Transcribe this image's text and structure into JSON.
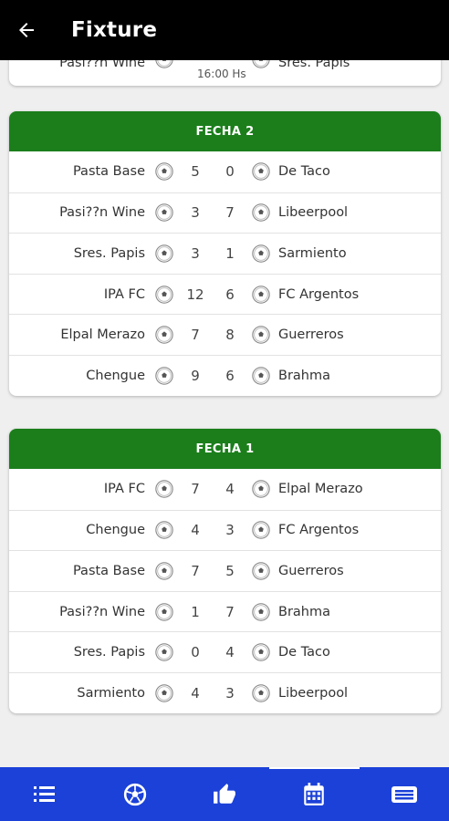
{
  "appbar": {
    "title": "Fixture"
  },
  "partial_match": {
    "home": "Pasi??n Wine",
    "time": "16:00 Hs",
    "away": "Sres. Papis"
  },
  "fechas": [
    {
      "title": "FECHA 2",
      "matches": [
        {
          "home": "Pasta Base",
          "home_score": "5",
          "away_score": "0",
          "away": "De Taco"
        },
        {
          "home": "Pasi??n Wine",
          "home_score": "3",
          "away_score": "7",
          "away": "Libeerpool"
        },
        {
          "home": "Sres. Papis",
          "home_score": "3",
          "away_score": "1",
          "away": "Sarmiento"
        },
        {
          "home": "IPA FC",
          "home_score": "12",
          "away_score": "6",
          "away": "FC Argentos"
        },
        {
          "home": "Elpal Merazo",
          "home_score": "7",
          "away_score": "8",
          "away": "Guerreros"
        },
        {
          "home": "Chengue",
          "home_score": "9",
          "away_score": "6",
          "away": "Brahma"
        }
      ]
    },
    {
      "title": "FECHA 1",
      "matches": [
        {
          "home": "IPA FC",
          "home_score": "7",
          "away_score": "4",
          "away": "Elpal Merazo"
        },
        {
          "home": "Chengue",
          "home_score": "4",
          "away_score": "3",
          "away": "FC Argentos"
        },
        {
          "home": "Pasta Base",
          "home_score": "7",
          "away_score": "5",
          "away": "Guerreros"
        },
        {
          "home": "Pasi??n Wine",
          "home_score": "1",
          "away_score": "7",
          "away": "Brahma"
        },
        {
          "home": "Sres. Papis",
          "home_score": "0",
          "away_score": "4",
          "away": "De Taco"
        },
        {
          "home": "Sarmiento",
          "home_score": "4",
          "away_score": "3",
          "away": "Libeerpool"
        }
      ]
    }
  ],
  "bottom_nav": {
    "items": [
      {
        "icon": "list-icon"
      },
      {
        "icon": "soccer-ball-icon"
      },
      {
        "icon": "thumbs-up-icon"
      },
      {
        "icon": "calendar-icon",
        "active": true
      },
      {
        "icon": "news-card-icon"
      }
    ]
  },
  "colors": {
    "header_green": "#1b7e1b",
    "nav_blue": "#1b41d8",
    "appbar": "#000000"
  }
}
